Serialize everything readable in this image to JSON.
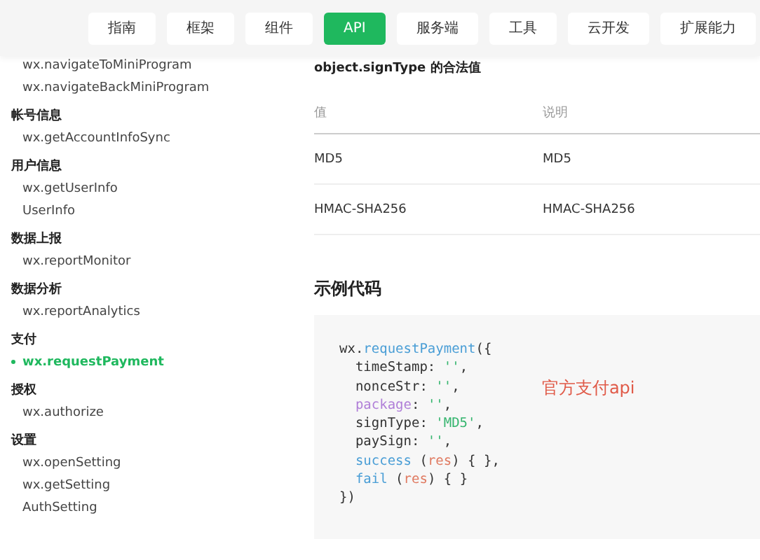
{
  "nav_tabs": [
    {
      "label": "指南",
      "selected": false
    },
    {
      "label": "框架",
      "selected": false
    },
    {
      "label": "组件",
      "selected": false
    },
    {
      "label": "API",
      "selected": true
    },
    {
      "label": "服务端",
      "selected": false
    },
    {
      "label": "工具",
      "selected": false
    },
    {
      "label": "云开发",
      "selected": false
    },
    {
      "label": "扩展能力",
      "selected": false
    }
  ],
  "sidebar": {
    "groups": [
      {
        "items": [
          {
            "label": "wx.navigateToMiniProgram",
            "selected": false
          },
          {
            "label": "wx.navigateBackMiniProgram",
            "selected": false
          }
        ]
      },
      {
        "title": "帐号信息",
        "items": [
          {
            "label": "wx.getAccountInfoSync",
            "selected": false
          }
        ]
      },
      {
        "title": "用户信息",
        "items": [
          {
            "label": "wx.getUserInfo",
            "selected": false
          },
          {
            "label": "UserInfo",
            "selected": false
          }
        ]
      },
      {
        "title": "数据上报",
        "items": [
          {
            "label": "wx.reportMonitor",
            "selected": false
          }
        ]
      },
      {
        "title": "数据分析",
        "items": [
          {
            "label": "wx.reportAnalytics",
            "selected": false
          }
        ]
      },
      {
        "title": "支付",
        "items": [
          {
            "label": "wx.requestPayment",
            "selected": true
          }
        ]
      },
      {
        "title": "授权",
        "items": [
          {
            "label": "wx.authorize",
            "selected": false
          }
        ]
      },
      {
        "title": "设置",
        "items": [
          {
            "label": "wx.openSetting",
            "selected": false
          },
          {
            "label": "wx.getSetting",
            "selected": false
          },
          {
            "label": "AuthSetting",
            "selected": false
          }
        ]
      }
    ]
  },
  "content": {
    "table_title": "object.signType 的合法值",
    "table": {
      "columns": [
        "值",
        "说明"
      ],
      "rows": [
        [
          "MD5",
          "MD5"
        ],
        [
          "HMAC-SHA256",
          "HMAC-SHA256"
        ]
      ]
    },
    "code_heading": "示例代码",
    "code_lines": [
      {
        "indented": false,
        "tokens": [
          {
            "text": "wx.",
            "kind": "plain"
          },
          {
            "text": "requestPayment",
            "kind": "fn"
          },
          {
            "text": "({",
            "kind": "plain"
          }
        ]
      },
      {
        "indented": true,
        "tokens": [
          {
            "text": "timeStamp: ",
            "kind": "plain"
          },
          {
            "text": "''",
            "kind": "string"
          },
          {
            "text": ",",
            "kind": "plain"
          }
        ]
      },
      {
        "indented": true,
        "tokens": [
          {
            "text": "nonceStr: ",
            "kind": "plain"
          },
          {
            "text": "''",
            "kind": "string"
          },
          {
            "text": ",",
            "kind": "plain"
          }
        ]
      },
      {
        "indented": true,
        "tokens": [
          {
            "text": "package",
            "kind": "keyword"
          },
          {
            "text": ": ",
            "kind": "plain"
          },
          {
            "text": "''",
            "kind": "string"
          },
          {
            "text": ",",
            "kind": "plain"
          }
        ]
      },
      {
        "indented": true,
        "tokens": [
          {
            "text": "signType: ",
            "kind": "plain"
          },
          {
            "text": "'MD5'",
            "kind": "string"
          },
          {
            "text": ",",
            "kind": "plain"
          }
        ]
      },
      {
        "indented": true,
        "tokens": [
          {
            "text": "paySign: ",
            "kind": "plain"
          },
          {
            "text": "''",
            "kind": "string"
          },
          {
            "text": ",",
            "kind": "plain"
          }
        ]
      },
      {
        "indented": true,
        "tokens": [
          {
            "text": "success",
            "kind": "fn"
          },
          {
            "text": " (",
            "kind": "plain"
          },
          {
            "text": "res",
            "kind": "param"
          },
          {
            "text": ") { },",
            "kind": "plain"
          }
        ]
      },
      {
        "indented": true,
        "tokens": [
          {
            "text": "fail",
            "kind": "fn"
          },
          {
            "text": " (",
            "kind": "plain"
          },
          {
            "text": "res",
            "kind": "param"
          },
          {
            "text": ") { }",
            "kind": "plain"
          }
        ]
      },
      {
        "indented": false,
        "tokens": [
          {
            "text": "})",
            "kind": "plain"
          }
        ]
      }
    ],
    "annotation": "官方支付api"
  }
}
